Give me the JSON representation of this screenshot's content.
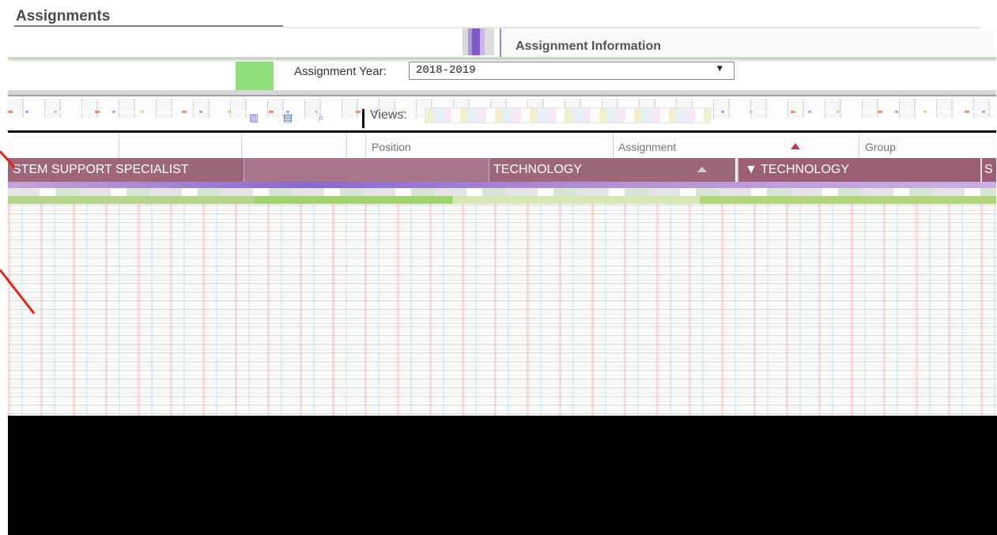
{
  "page": {
    "title": "Assignments"
  },
  "tabs": {
    "assignment_info": "Assignment Information"
  },
  "assignment_year": {
    "label": "Assignment Year:",
    "value": "2018-2019",
    "arrow": "▼"
  },
  "toolbar": {
    "icons": [
      "chart-icon",
      "print-icon",
      "zoom-icon"
    ],
    "views_label": "Views:"
  },
  "grid": {
    "headers": [
      "Position",
      "Assignment",
      "Group"
    ],
    "row": {
      "assignment": "STEM SUPPORT SPECIALIST",
      "building": "TECHNOLOGY",
      "group": "TECHNOLOGY",
      "extra": "S"
    }
  },
  "colors": {
    "row_bg": "#9e6679",
    "annotation_arrow": "#e3241b",
    "accent_purple": "#8b67cf"
  }
}
